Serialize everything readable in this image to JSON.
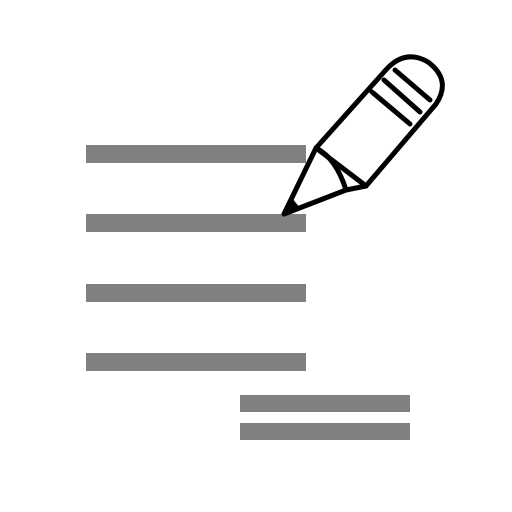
{
  "icon": {
    "name": "edit-document-icon",
    "colors": {
      "background": "#ffffff",
      "line": "#808080",
      "outline": "#000000",
      "fill": "#ffffff"
    }
  }
}
